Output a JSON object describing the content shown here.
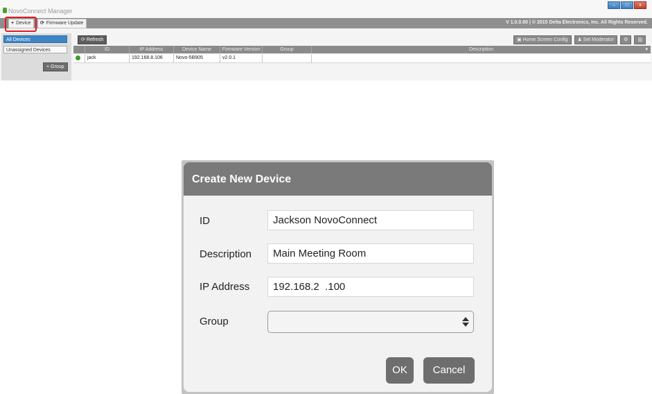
{
  "app": {
    "title": "NovoConnect Manager",
    "window_buttons": [
      "–",
      "□",
      "x"
    ],
    "toolbar": {
      "device_label": "Device",
      "device_glyph": "+",
      "firmware_label": "Firmware Update",
      "firmware_glyph": "⟳",
      "version_text": "V 1.0.0.60  |  © 2015 Delta Electronics, Inc. All Rights Reserved."
    },
    "sidebar": {
      "items": [
        {
          "label": "All Devices",
          "active": true
        },
        {
          "label": "Unassigned Devices",
          "active": false
        }
      ],
      "add_group_label": "+ Group"
    },
    "actions": {
      "refresh_label": "Refresh",
      "home_screen_label": "Home Screen Config",
      "set_moderator_label": "Set Moderator"
    },
    "grid": {
      "columns": [
        "ID",
        "IP Address",
        "Device Name",
        "Firmware Version",
        "Group",
        "Description"
      ],
      "rows": [
        {
          "id": "jack",
          "ip": "192.168.8.106",
          "device_name": "Novo-5B905",
          "firmware": "v2.0.1",
          "group": "",
          "description": "",
          "status": "online"
        }
      ]
    },
    "highlight_color": "#e31b23"
  },
  "dialog": {
    "title": "Create New Device",
    "fields": {
      "id_label": "ID",
      "id_value": "Jackson NovoConnect",
      "description_label": "Description",
      "description_value": "Main Meeting Room",
      "ip_label": "IP Address",
      "ip_value": "192.168.2  .100",
      "group_label": "Group",
      "group_value": ""
    },
    "ok_label": "OK",
    "cancel_label": "Cancel"
  }
}
